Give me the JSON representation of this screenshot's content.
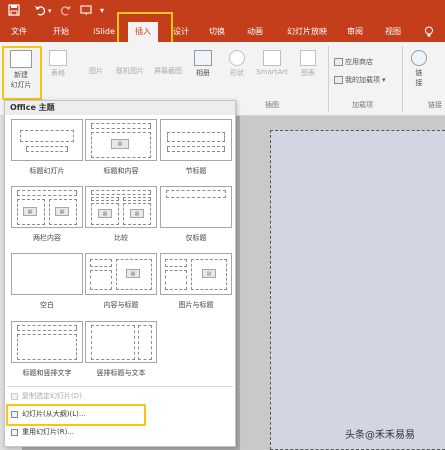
{
  "quick_access": {
    "save_icon": "save-icon",
    "undo_icon": "undo-icon",
    "redo_icon": "redo-icon",
    "customize_icon": "customize-icon"
  },
  "tabs": [
    {
      "label": "文件"
    },
    {
      "label": "开始"
    },
    {
      "label": "iSlide"
    },
    {
      "label": "插入",
      "active": true
    },
    {
      "label": "设计"
    },
    {
      "label": "切换"
    },
    {
      "label": "动画"
    },
    {
      "label": "幻灯片放映"
    },
    {
      "label": "审阅"
    },
    {
      "label": "视图"
    }
  ],
  "tabs_more_icon": "lightbulb-icon",
  "ribbon": {
    "new_slide": {
      "line1": "新建",
      "line2": "幻灯片"
    },
    "table": {
      "label": "表格"
    },
    "images": {
      "label": "图片"
    },
    "online_pictures": {
      "label": "联机图片"
    },
    "screenshot": {
      "label": "屏幕截图"
    },
    "album": {
      "label": "相册"
    },
    "shapes": {
      "label": "形状"
    },
    "smartart": {
      "label": "SmartArt"
    },
    "chart": {
      "label": "图表"
    },
    "illustrations_group": "插图",
    "app_store": "应用商店",
    "my_addins": "我的加载项",
    "addins_group": "加载项",
    "link": {
      "line1": "链",
      "line2": "接"
    },
    "links_group": "链接"
  },
  "gallery": {
    "header": "Office 主题",
    "layouts": [
      {
        "name": "标题幻灯片"
      },
      {
        "name": "标题和内容"
      },
      {
        "name": "节标题"
      },
      {
        "name": "两栏内容"
      },
      {
        "name": "比较"
      },
      {
        "name": "仅标题"
      },
      {
        "name": "空白"
      },
      {
        "name": "内容与标题"
      },
      {
        "name": "图片与标题"
      },
      {
        "name": "标题和竖排文字"
      },
      {
        "name": "竖排标题与文本"
      }
    ],
    "menu": [
      {
        "label": "复制选定幻灯片(D)",
        "disabled": true
      },
      {
        "label": "幻灯片(从大纲)(L)..."
      },
      {
        "label": "重用幻灯片(R)..."
      }
    ]
  },
  "watermark": "头条@禾禾易易"
}
